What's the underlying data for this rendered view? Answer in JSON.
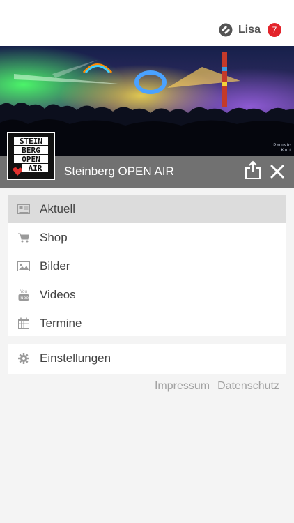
{
  "user": {
    "name": "Lisa",
    "notifications": "7"
  },
  "event": {
    "title": "Steinberg OPEN AIR"
  },
  "logo": {
    "lines": [
      "STEIN",
      "BERG",
      "OPEN",
      "AIR"
    ]
  },
  "photo_credit": [
    "Pmusic",
    "Kult"
  ],
  "menu": {
    "items": [
      {
        "label": "Aktuell",
        "icon": "newspaper-icon",
        "active": true
      },
      {
        "label": "Shop",
        "icon": "cart-icon",
        "active": false
      },
      {
        "label": "Bilder",
        "icon": "image-icon",
        "active": false
      },
      {
        "label": "Videos",
        "icon": "youtube-icon",
        "active": false
      },
      {
        "label": "Termine",
        "icon": "calendar-icon",
        "active": false
      }
    ]
  },
  "settings": {
    "label": "Einstellungen",
    "icon": "gear-icon"
  },
  "footer": {
    "impressum": "Impressum",
    "datenschutz": "Datenschutz"
  },
  "colors": {
    "badge": "#e3242b",
    "titlebar": "#717171",
    "active_item": "#dcdcdc"
  }
}
